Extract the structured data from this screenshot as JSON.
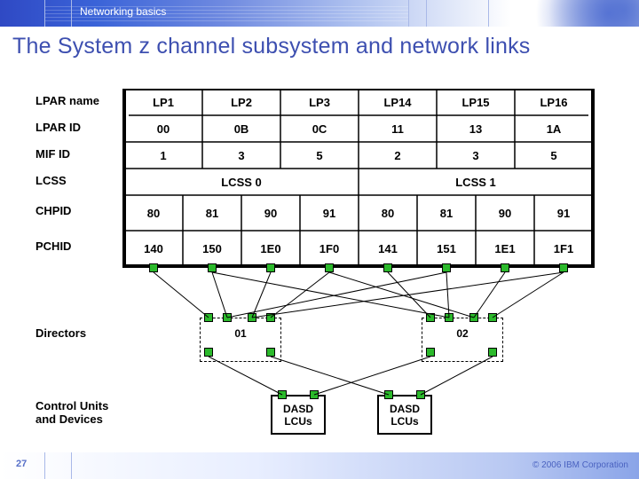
{
  "header": {
    "breadcrumb": "Networking basics"
  },
  "title": "The System z channel subsystem and network links",
  "labels": {
    "lpar_name": "LPAR name",
    "lpar_id": "LPAR ID",
    "mif_id": "MIF ID",
    "lcss": "LCSS",
    "chpid": "CHPID",
    "pchid": "PCHID",
    "directors": "Directors",
    "control_units": "Control Units\nand Devices"
  },
  "lpar_name_values": [
    "LP1",
    "LP2",
    "LP3",
    "LP14",
    "LP15",
    "LP16"
  ],
  "lpar_id_values": [
    "00",
    "0B",
    "0C",
    "11",
    "13",
    "1A"
  ],
  "mif_id_values": [
    "1",
    "3",
    "5",
    "2",
    "3",
    "5"
  ],
  "lcss_labels": [
    "LCSS 0",
    "LCSS 1"
  ],
  "chpid_values": [
    "80",
    "81",
    "90",
    "91",
    "80",
    "81",
    "90",
    "91"
  ],
  "pchid_values": [
    "140",
    "150",
    "1E0",
    "1F0",
    "141",
    "151",
    "1E1",
    "1F1"
  ],
  "director_ids": [
    "01",
    "02"
  ],
  "dasd_label_1": "DASD",
  "dasd_label_2": "LCUs",
  "footer": {
    "page": "27",
    "copyright": "© 2006 IBM Corporation"
  }
}
